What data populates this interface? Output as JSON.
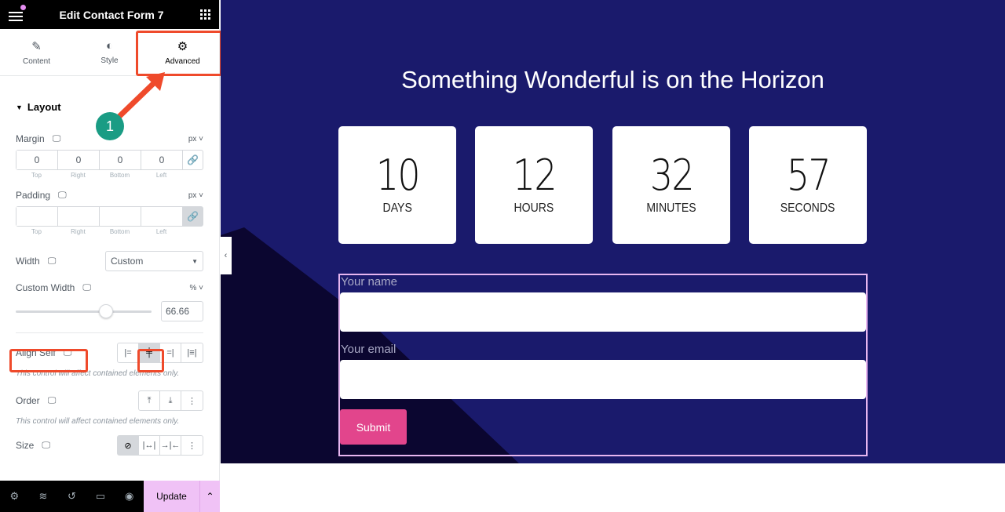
{
  "editor": {
    "title": "Edit Contact Form 7",
    "tabs": [
      {
        "label": "Content",
        "icon": "pencil-icon"
      },
      {
        "label": "Style",
        "icon": "half-circle-icon"
      },
      {
        "label": "Advanced",
        "icon": "gear-icon",
        "active": true
      }
    ],
    "section_title": "Layout",
    "margin": {
      "label": "Margin",
      "unit": "px",
      "values": [
        "0",
        "0",
        "0",
        "0"
      ],
      "linked": false
    },
    "padding": {
      "label": "Padding",
      "unit": "px",
      "values": [
        "",
        "",
        "",
        ""
      ],
      "linked": true
    },
    "dim_labels": [
      "Top",
      "Right",
      "Bottom",
      "Left"
    ],
    "width": {
      "label": "Width",
      "value": "Custom"
    },
    "custom_width": {
      "label": "Custom Width",
      "unit": "%",
      "value": "66.66",
      "slider_percent": 66.66
    },
    "align_self": {
      "label": "Align Self",
      "options": [
        "start",
        "center",
        "end",
        "stretch"
      ],
      "selected": "center"
    },
    "order": {
      "label": "Order",
      "options": [
        "start",
        "end",
        "custom"
      ]
    },
    "size": {
      "label": "Size",
      "options": [
        "none",
        "grow",
        "shrink",
        "custom"
      ],
      "selected": "none"
    },
    "note": "This control will affect contained elements only.",
    "bottom": {
      "update_label": "Update"
    },
    "annotation": {
      "step": "1"
    }
  },
  "page": {
    "heading": "Something Wonderful is on the Horizon",
    "countdown": [
      {
        "value": "10",
        "label": "DAYS"
      },
      {
        "value": "12",
        "label": "HOURS"
      },
      {
        "value": "32",
        "label": "MINUTES"
      },
      {
        "value": "57",
        "label": "SECONDS"
      }
    ],
    "form": {
      "name_label": "Your name",
      "email_label": "Your email",
      "submit_label": "Submit"
    }
  }
}
